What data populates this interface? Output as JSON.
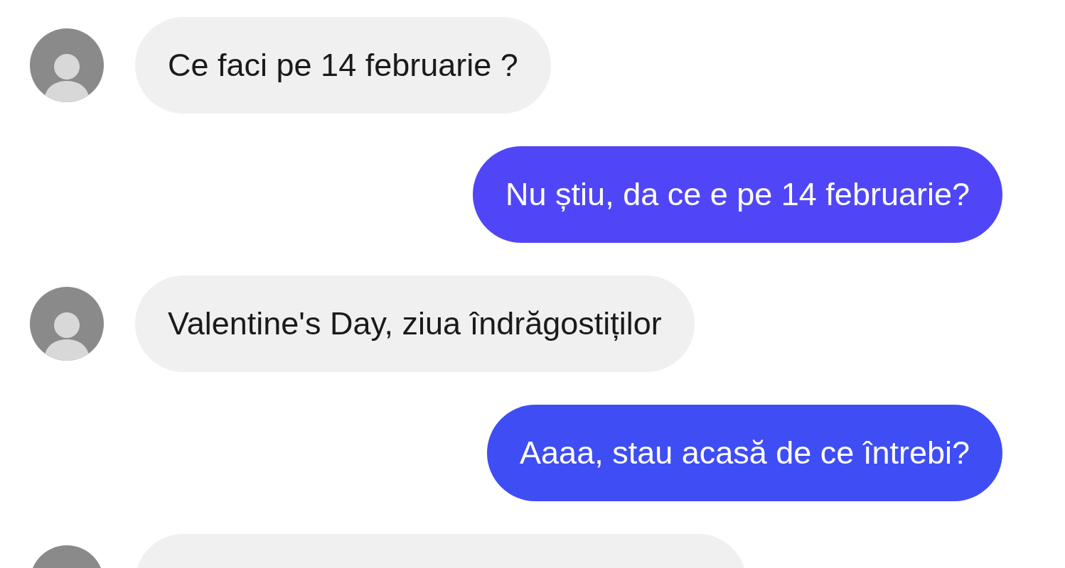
{
  "messages": [
    {
      "kind": "incoming",
      "text": "Ce faci pe 14 februarie ?"
    },
    {
      "kind": "outgoing",
      "text": "Nu știu, da ce e pe 14 februarie?",
      "color": "#5046f7"
    },
    {
      "kind": "incoming",
      "text": "Valentine's Day, ziua îndrăgostiților"
    },
    {
      "kind": "outgoing",
      "text": "Aaaa, stau acasă de ce întrebi?",
      "color": "#3f4df5"
    },
    {
      "kind": "incoming"
    }
  ]
}
